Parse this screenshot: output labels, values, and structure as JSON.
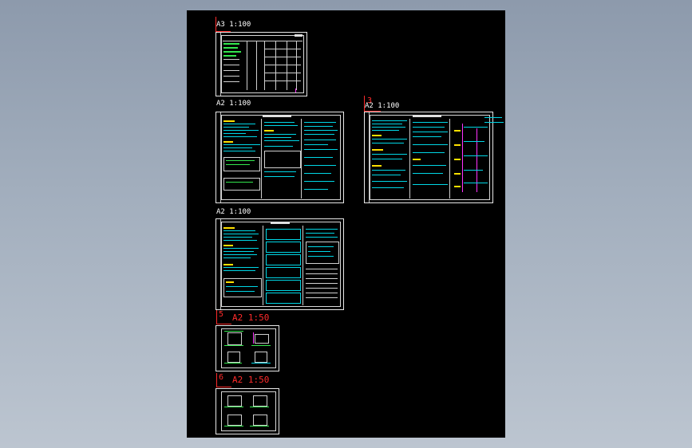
{
  "sheets": [
    {
      "scale_label": "A3 1:100"
    },
    {
      "scale_label": "A2 1:100"
    },
    {
      "scale_label": "A2 1:100",
      "index": "3"
    },
    {
      "scale_label": "A2 1:100"
    },
    {
      "scale_label": "A2 1:50",
      "index": "5"
    },
    {
      "scale_label": "A2 1:50",
      "index": "6"
    }
  ],
  "colors": {
    "background_top": "#8d9aac",
    "background_bottom": "#bcc5d0",
    "model_space": "#000000",
    "label_red": "#ff2b2b",
    "text_cyan": "#00d7e6",
    "text_green": "#33e64d",
    "text_yellow": "#ffe000",
    "marker_magenta": "#ff33cc"
  }
}
